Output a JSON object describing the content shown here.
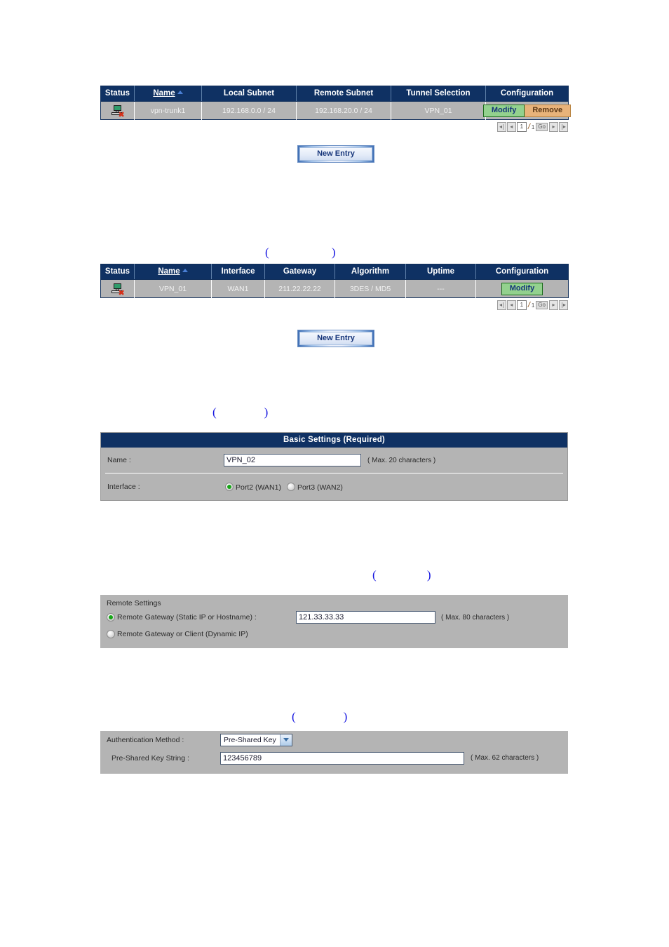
{
  "vpn_tunnel_table": {
    "headers": [
      "Status",
      "Name",
      "Local Subnet",
      "Remote Subnet",
      "Tunnel Selection",
      "Configuration"
    ],
    "sort_column": "Name",
    "sort_direction": "ascending",
    "rows": [
      {
        "status_icon": "computer-disconnected-icon",
        "name": "vpn-trunk1",
        "local_subnet": "192.168.0.0 / 24",
        "remote_subnet": "192.168.20.0 / 24",
        "tunnel_selection": "VPN_01",
        "modify_label": "Modify",
        "remove_label": "Remove"
      }
    ],
    "pager": {
      "first_icon": "first-page-icon",
      "prev_icon": "previous-page-icon",
      "current_page": "1",
      "separator": "/",
      "total_pages": "1",
      "go_label": "Go",
      "next_icon": "next-page-icon",
      "last_icon": "last-page-icon"
    },
    "new_entry_label": "New Entry"
  },
  "ipsec_table": {
    "headers": [
      "Status",
      "Name",
      "Interface",
      "Gateway",
      "Algorithm",
      "Uptime",
      "Configuration"
    ],
    "sort_column": "Name",
    "sort_direction": "ascending",
    "rows": [
      {
        "status_icon": "computer-disconnected-icon",
        "name": "VPN_01",
        "interface": "WAN1",
        "gateway": "211.22.22.22",
        "algorithm": "3DES / MD5",
        "uptime": "---",
        "modify_label": "Modify"
      }
    ],
    "pager": {
      "first_icon": "first-page-icon",
      "prev_icon": "previous-page-icon",
      "current_page": "1",
      "separator": "/",
      "total_pages": "1",
      "go_label": "Go",
      "next_icon": "next-page-icon",
      "last_icon": "last-page-icon"
    },
    "new_entry_label": "New Entry"
  },
  "captions": {
    "caption_1": "(                     )",
    "caption_2": "(                )",
    "caption_3": "(                 )",
    "caption_4": "(                )"
  },
  "basic_settings": {
    "title": "Basic Settings (Required)",
    "name_label": "Name :",
    "name_value": "VPN_02",
    "name_hint": "( Max. 20 characters )",
    "interface_label": "Interface :",
    "interface_options": [
      {
        "label": "Port2 (WAN1)",
        "selected": true
      },
      {
        "label": "Port3 (WAN2)",
        "selected": false
      }
    ]
  },
  "remote_settings": {
    "title": "Remote Settings",
    "options": [
      {
        "label": "Remote Gateway (Static IP or Hostname) :",
        "selected": true
      },
      {
        "label": "Remote Gateway or Client (Dynamic IP)",
        "selected": false
      }
    ],
    "gateway_value": "121.33.33.33",
    "gateway_hint": "( Max. 80 characters )"
  },
  "authentication": {
    "method_label": "Authentication Method :",
    "method_value": "Pre-Shared Key",
    "key_label": "Pre-Shared Key String :",
    "key_value": "123456789",
    "key_hint": "( Max. 62 characters )"
  },
  "colors": {
    "header_blue": "#0f3163",
    "row_gray": "#b4b4b4",
    "modify_green": "#93d18e",
    "remove_tan": "#e8b37a",
    "accent_blue": "#1414e0",
    "radio_green": "#16a516"
  }
}
